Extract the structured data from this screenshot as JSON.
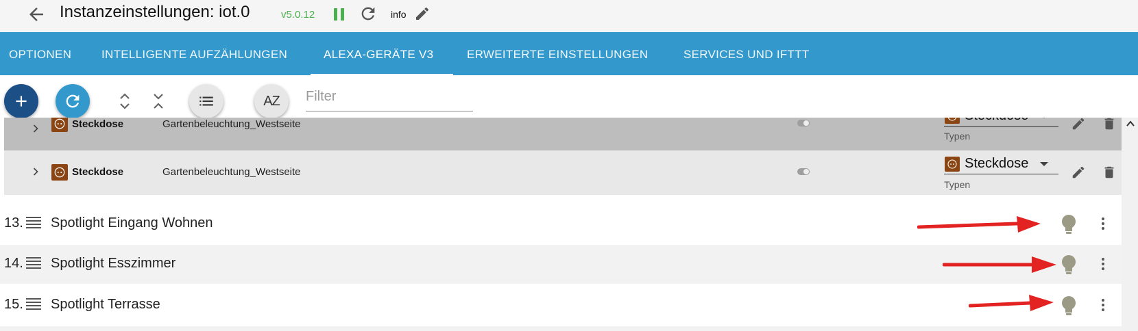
{
  "header": {
    "title": "Instanzeinstellungen: iot.0",
    "version": "v5.0.12",
    "log_level": "info",
    "icons": {
      "back": "arrow-left-icon",
      "pause": "pause-icon",
      "reload": "reload-icon",
      "edit": "pencil-icon"
    },
    "colors": {
      "version": "#4caf50",
      "background": "#f5f5f5"
    }
  },
  "tabs": [
    {
      "label": "OPTIONEN",
      "active": false
    },
    {
      "label": "INTELLIGENTE AUFZÄHLUNGEN",
      "active": false
    },
    {
      "label": "ALEXA-GERÄTE V3",
      "active": true
    },
    {
      "label": "ERWEITERTE EINSTELLUNGEN",
      "active": false
    },
    {
      "label": "SERVICES UND IFTTT",
      "active": false
    }
  ],
  "tabs_color": "#3399cc",
  "toolbar": {
    "add_icon": "plus-icon",
    "refresh_icon": "refresh-icon",
    "expand_icon": "unfold-more-icon",
    "collapse_icon": "unfold-less-icon",
    "list_icon": "list-icon",
    "sort_icon": "sort-az-icon",
    "sort_label": "AZ",
    "filter_placeholder": "Filter",
    "colors": {
      "add": "#1b4f86",
      "refresh": "#3399cc"
    }
  },
  "smart_devices": [
    {
      "type": "Steckdose",
      "name": "Gartenbeleuchtung_Westseite",
      "select_value": "Steckdose",
      "select_label": "Typen",
      "selected": true
    },
    {
      "type": "Steckdose",
      "name": "Gartenbeleuchtung_Westseite",
      "select_value": "Steckdose",
      "select_label": "Typen",
      "selected": false
    }
  ],
  "items": [
    {
      "num": "13.",
      "label": "Spotlight Eingang Wohnen",
      "icon": "light-bulb-icon"
    },
    {
      "num": "14.",
      "label": "Spotlight Esszimmer",
      "icon": "light-bulb-icon"
    },
    {
      "num": "15.",
      "label": "Spotlight Terrasse",
      "icon": "light-bulb-icon"
    }
  ],
  "annotation_color": "#e32222"
}
